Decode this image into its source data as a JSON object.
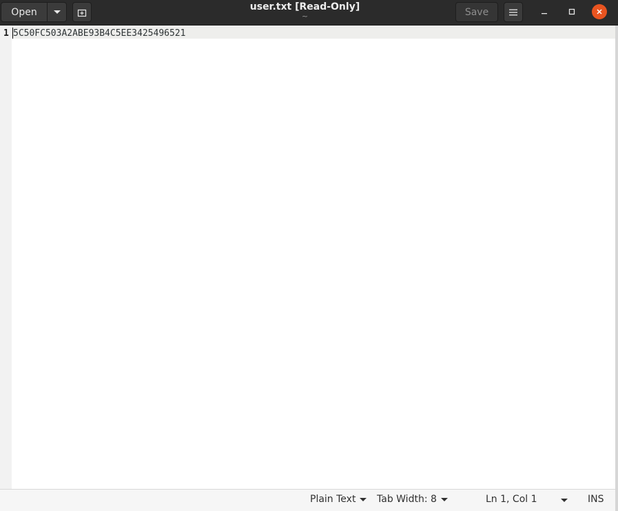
{
  "header": {
    "open_label": "Open",
    "save_label": "Save",
    "title": "user.txt [Read-Only]",
    "subtitle": "~"
  },
  "editor": {
    "line_number": "1",
    "line_text": "5C50FC503A2ABE93B4C5EE3425496521"
  },
  "statusbar": {
    "syntax": "Plain Text",
    "tab_width": "Tab Width: 8",
    "position": "Ln 1, Col 1",
    "mode": "INS"
  },
  "icons": {
    "open_menu": "chevron-down-icon",
    "new_tab": "new-tab-icon",
    "menu": "hamburger-icon",
    "minimize": "minimize-icon",
    "maximize": "maximize-icon",
    "close": "close-icon"
  },
  "colors": {
    "headerbar": "#2b2b2b",
    "close_button": "#e95420",
    "gutter": "#f2f2f2",
    "current_line": "#eeeeec"
  }
}
